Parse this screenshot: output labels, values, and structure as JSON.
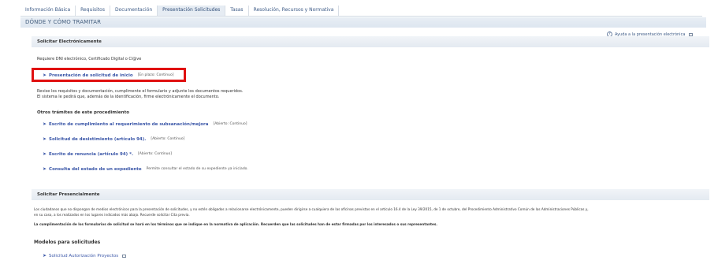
{
  "tabs": [
    {
      "label": "Información Básica"
    },
    {
      "label": "Requisitos"
    },
    {
      "label": "Documentación"
    },
    {
      "label": "Presentación Solicitudes"
    },
    {
      "label": "Tasas"
    },
    {
      "label": "Resolución, Recursos y Normativa"
    }
  ],
  "section_title": "DÓNDE Y CÓMO TRAMITAR",
  "help_link": "Ayuda a la presentación electrónica",
  "electronic": {
    "title": "Solicitar Electrónicamente",
    "requires": "Requiere DNI electrónico, Certificado Digital o Cl@ve",
    "main_link": "Presentación de solicitud de inicio",
    "main_tag": "[En plazo: Continuo]",
    "instructions_1": "Revise los requisitos y documentación, cumplimente el formulario y adjunte los documentos requeridos.",
    "instructions_2": "El sistema le pedirá que, además de la identificación, firme electrónicamente el documento.",
    "other_title": "Otros trámites de este procedimiento",
    "other": [
      {
        "label": "Escrito de cumplimiento al requerimiento de subsanación/mejora",
        "tag": "[Abierto: Continuo]"
      },
      {
        "label": "Solicitud de desistimiento (artículo 94).",
        "tag": "[Abierto: Continuo]"
      },
      {
        "label": "Escrito de renuncia (artículo 94) *.",
        "tag": "[Abierto: Continuo]"
      },
      {
        "label": "Consulta del estado de un expediente",
        "tag": "Permite consultar el estado de su expediente ya iniciado."
      }
    ]
  },
  "presencial": {
    "title": "Solicitar Presencialmente",
    "text_1": "Los ciudadanos que no dispongan de medios electrónicos para la presentación de solicitudes, y no estén obligados a relacionarse electrónicamente, pueden dirigirse a cualquiera de las oficinas previstas en el artículo 16.4 de la Ley 39/2015, de 1 de octubre, del Procedimiento Administrativo Común de las Administraciones Públicas y,",
    "text_2": "en su caso, a los realizados en los lugares indicados más abajo. Recuerde solicitar Cita previa.",
    "text_3": "La cumplimentación de los formularios de solicitud se hará en los términos que se indique en la normativa de aplicación. Recuerden que las solicitudes han de estar firmadas por los interesados o sus representantes."
  },
  "models": {
    "title": "Modelos para solicitudes",
    "link": "Solicitud Autorización Proyectos"
  }
}
